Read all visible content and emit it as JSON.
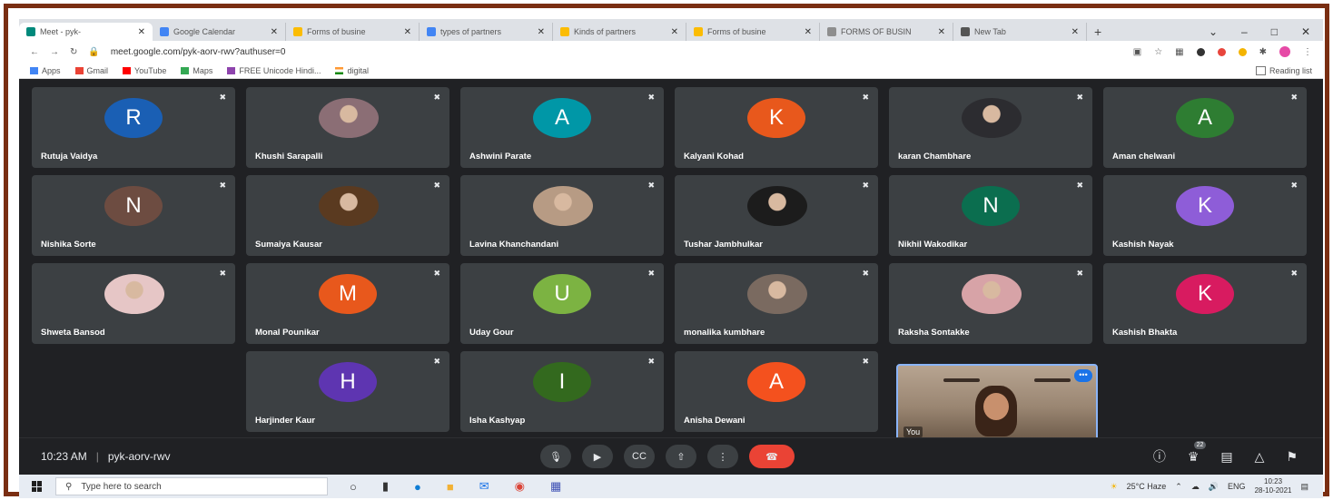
{
  "browser": {
    "tabs": [
      {
        "title": "Meet - pyk-",
        "color": "#00897b",
        "active": true
      },
      {
        "title": "Google Calendar",
        "color": "#4285f4"
      },
      {
        "title": "Forms of busine",
        "color": "#fbbc04"
      },
      {
        "title": "types of partners",
        "color": "#4285f4"
      },
      {
        "title": "Kinds of partners",
        "color": "#fbbc04"
      },
      {
        "title": "Forms of busine",
        "color": "#fbbc04"
      },
      {
        "title": "FORMS OF BUSIN",
        "color": "#8e8e8e"
      },
      {
        "title": "New Tab",
        "color": "#555555"
      }
    ],
    "new_tab": "+",
    "url": "meet.google.com/pyk-aorv-rwv?authuser=0",
    "bookmarks": [
      "Apps",
      "Gmail",
      "YouTube",
      "Maps",
      "FREE Unicode Hindi...",
      "digital"
    ],
    "reading_list": "Reading list"
  },
  "participants": [
    {
      "name": "Rutuja Vaidya",
      "initial": "R",
      "color": "#1a5fb4"
    },
    {
      "name": "Khushi Sarapalli",
      "photo": "#8b6e75"
    },
    {
      "name": "Ashwini Parate",
      "initial": "A",
      "color": "#0097a7"
    },
    {
      "name": "Kalyani Kohad",
      "initial": "K",
      "color": "#e8581c"
    },
    {
      "name": "karan Chambhare",
      "photo": "#2c2c30"
    },
    {
      "name": "Aman chelwani",
      "initial": "A",
      "color": "#2e7d32"
    },
    {
      "name": "Nishika Sorte",
      "initial": "N",
      "color": "#6d4c41"
    },
    {
      "name": "Sumaiya Kausar",
      "photo": "#5a3a20"
    },
    {
      "name": "Lavina Khanchandani",
      "photo": "#b79b84"
    },
    {
      "name": "Tushar Jambhulkar",
      "photo": "#1c1c1c"
    },
    {
      "name": "Nikhil Wakodikar",
      "initial": "N",
      "color": "#0b6e4f"
    },
    {
      "name": "Kashish Nayak",
      "initial": "K",
      "color": "#8e5dd8"
    },
    {
      "name": "Shweta Bansod",
      "photo": "#e6c6c6"
    },
    {
      "name": "Monal Pounikar",
      "initial": "M",
      "color": "#e8581c"
    },
    {
      "name": "Uday Gour",
      "initial": "U",
      "color": "#7cb342"
    },
    {
      "name": "monalika kumbhare",
      "photo": "#7a6a60"
    },
    {
      "name": "Raksha Sontakke",
      "photo": "#d7a3a7"
    },
    {
      "name": "Kashish Bhakta",
      "initial": "K",
      "color": "#d81b60"
    },
    {
      "name": "Harjinder Kaur",
      "initial": "H",
      "color": "#5e35b1"
    },
    {
      "name": "Isha Kashyap",
      "initial": "I",
      "color": "#33691e"
    },
    {
      "name": "Anisha Dewani",
      "initial": "A",
      "color": "#f4511e"
    }
  ],
  "self_view": {
    "label": "You",
    "more": "•••"
  },
  "meeting": {
    "time": "10:23 AM",
    "code": "pyk-aorv-rwv",
    "participant_count": "22"
  },
  "taskbar": {
    "search_placeholder": "Type here to search",
    "weather": "25°C Haze",
    "lang": "ENG",
    "time": "10:23",
    "date": "28-10-2021"
  }
}
